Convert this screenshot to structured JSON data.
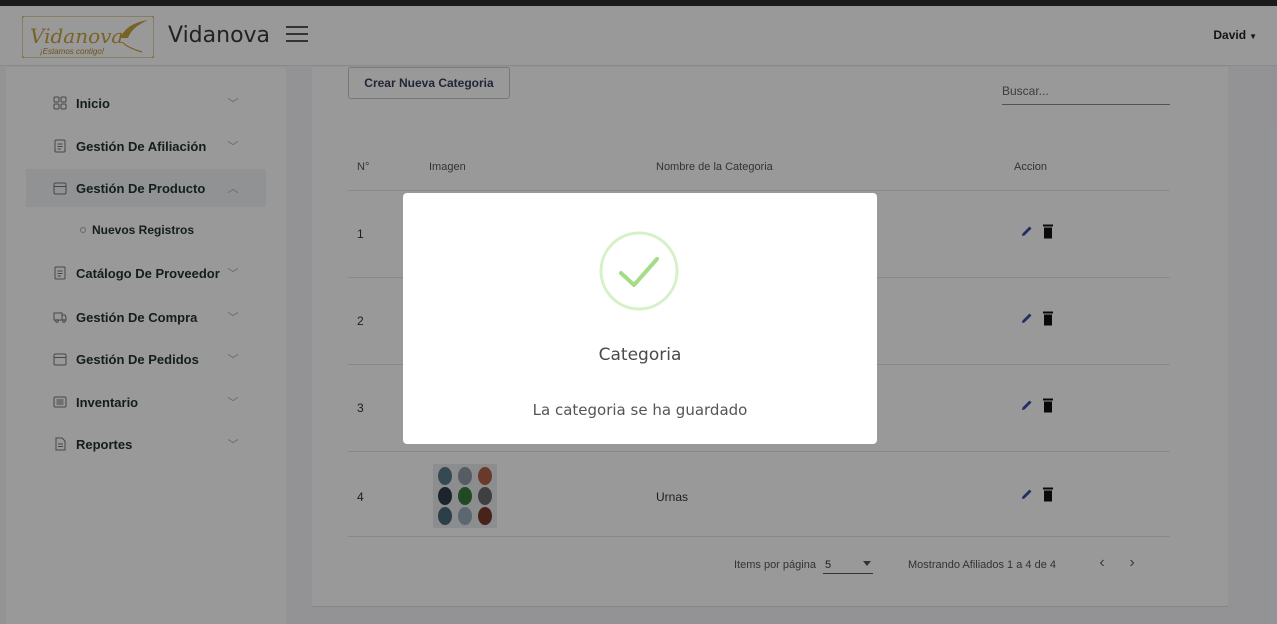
{
  "header": {
    "logo_text": "Vidanova",
    "logo_tagline": "¡Estamos contigo!",
    "brand": "Vidanova",
    "user": "David",
    "menu_icon": "hamburger-icon"
  },
  "sidebar": {
    "items": [
      {
        "label": "Inicio",
        "icon": "grid-icon"
      },
      {
        "label": "Gestión De Afiliación",
        "icon": "document-icon"
      },
      {
        "label": "Gestión De Producto",
        "icon": "box-icon"
      },
      {
        "label": "Catálogo De Proveedor",
        "icon": "document-icon"
      },
      {
        "label": "Gestión De Compra",
        "icon": "truck-icon"
      },
      {
        "label": "Gestión De Pedidos",
        "icon": "box-icon"
      },
      {
        "label": "Inventario",
        "icon": "list-icon"
      },
      {
        "label": "Reportes",
        "icon": "file-icon"
      }
    ],
    "subitem": {
      "label": "Nuevos Registros"
    }
  },
  "main": {
    "create_button": "Crear Nueva Categoria",
    "search_placeholder": "Buscar...",
    "columns": [
      "N°",
      "Imagen",
      "Nombre de la Categoria",
      "Accion"
    ],
    "rows": [
      {
        "n": "1",
        "name": ""
      },
      {
        "n": "2",
        "name": ""
      },
      {
        "n": "3",
        "name": ""
      },
      {
        "n": "4",
        "name": "Urnas"
      }
    ],
    "paginator": {
      "items_label": "Items por página",
      "page_size": "5",
      "range": "Mostrando Afiliados 1 a 4 de 4"
    }
  },
  "modal": {
    "title": "Categoria",
    "message": "La categoria se ha guardado",
    "success_color": "#a5dc86"
  }
}
